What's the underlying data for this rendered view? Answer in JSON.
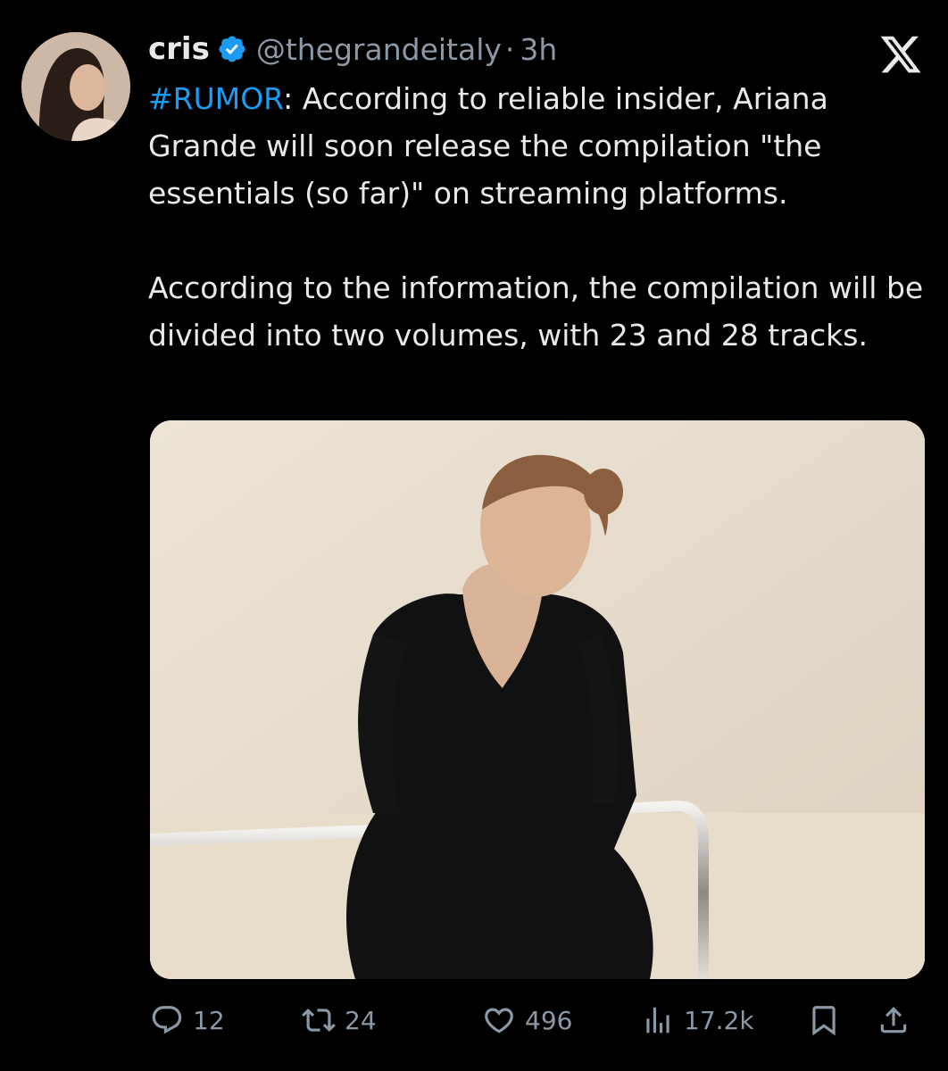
{
  "tweet": {
    "author_name": "cris",
    "handle": "@thegrandeitaly",
    "separator": "·",
    "time": "3h",
    "hashtag": "#RUMOR",
    "text_line1_rest": ": According to reliable insider, Ariana Grande will soon release the compilation \"the essentials (so far)\" on streaming platforms.",
    "text_paragraph2": "According to the information, the compilation will be divided into two volumes, with 23 and 28 tracks."
  },
  "actions": {
    "replies": "12",
    "reposts": "24",
    "likes": "496",
    "views": "17.2k"
  },
  "icons": {
    "verified": "verified-badge-icon",
    "logo": "x-logo-icon",
    "reply": "reply-icon",
    "repost": "repost-icon",
    "like": "heart-icon",
    "views": "views-icon",
    "bookmark": "bookmark-icon",
    "share": "share-icon"
  },
  "colors": {
    "background": "#000000",
    "text": "#e7e9ea",
    "secondary": "#8b98a5",
    "accent": "#1d9bf0"
  }
}
